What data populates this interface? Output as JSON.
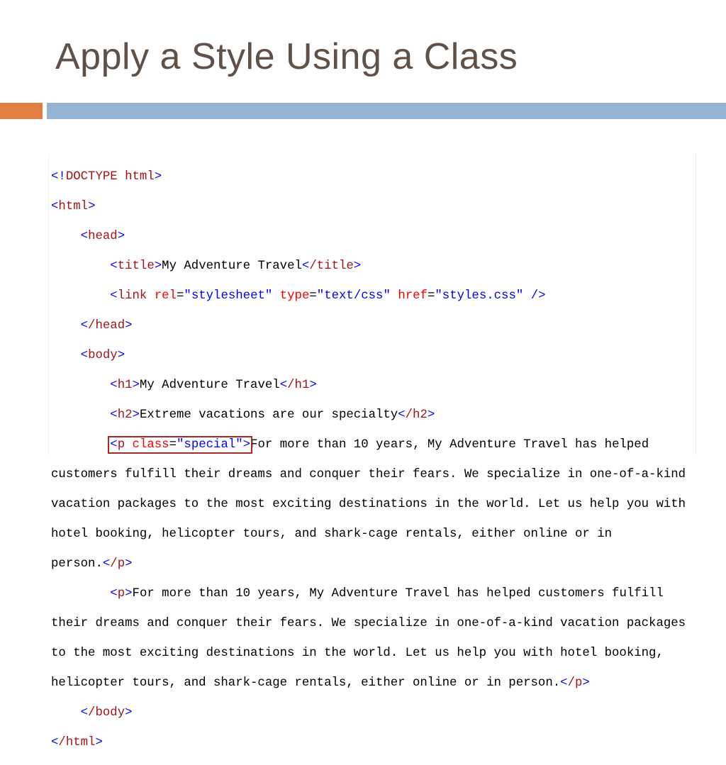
{
  "slide": {
    "title": "Apply a Style Using a Class"
  },
  "code": {
    "doctype_open": "<!",
    "doctype_kw": "DOCTYPE",
    "doctype_val": "html",
    "doctype_close": ">",
    "html_open_tag": "html",
    "head_tag": "head",
    "title_tag": "title",
    "title_text": "My Adventure Travel",
    "title_close_tag": "/title",
    "link_tag": "link",
    "link_rel_attr": "rel",
    "link_rel_val": "\"stylesheet\"",
    "link_type_attr": "type",
    "link_type_val": "\"text/css\"",
    "link_href_attr": "href",
    "link_href_val": "\"styles.css\"",
    "link_end": " />",
    "head_close_tag": "/head",
    "body_tag": "body",
    "h1_tag": "h1",
    "h1_text": "My Adventure Travel",
    "h1_close_tag": "/h1",
    "h2_tag": "h2",
    "h2_text": "Extreme vacations are our specialty",
    "h2_close_tag": "/h2",
    "p_special_tag": "p",
    "p_special_attr": "class",
    "p_special_val": "\"special\"",
    "p1_line1": "For more than 10 years, My Adventure Travel has helped",
    "p1_line2": "customers fulfill their dreams and conquer their fears. We specialize in one-of-a-kind",
    "p1_line3": "vacation packages to the most exciting destinations in the world. Let us help you with",
    "p1_line4": "hotel booking, helicopter tours, and shark-cage rentals, either online or in",
    "p1_line5": "person.",
    "p_close_tag": "/p",
    "p2_tag": "p",
    "p2_line1": "For more than 10 years, My Adventure Travel has helped customers fulfill",
    "p2_line2": "their dreams and conquer their fears. We specialize in one-of-a-kind vacation packages",
    "p2_line3": "to the most exciting destinations in the world. Let us help you with hotel booking,",
    "p2_line4": "helicopter tours, and shark-cage rentals, either online or in person.",
    "body_close_tag": "/body",
    "html_close_tag": "/html"
  },
  "colors": {
    "title": "#5f5148",
    "accent_orange": "#e07f41",
    "accent_blue": "#93b5d2",
    "code_tag": "#a31515",
    "code_attr": "#ff0000",
    "code_value": "#0000ff",
    "highlight_box": "#a52a2a"
  }
}
